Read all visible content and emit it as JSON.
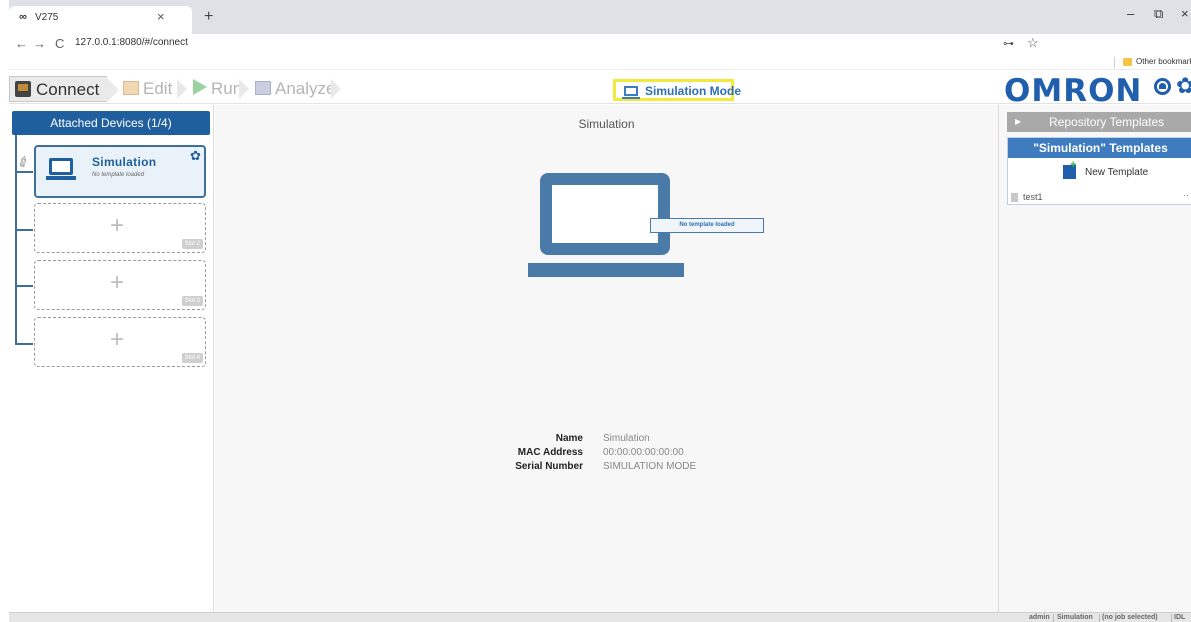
{
  "browser": {
    "tab_title": "V275",
    "tab_icon": "∞",
    "tab_close": "×",
    "new_tab": "+",
    "window_controls": {
      "minimize": "–",
      "restore": "⧉",
      "close": "×"
    },
    "nav": {
      "back": "←",
      "forward": "→",
      "reload": "C"
    },
    "url_info": "ⓘ",
    "url": "127.0.0.1:8080/#/connect",
    "key_icon": "⊶",
    "star_icon": "☆",
    "menu_icon": "⋮",
    "bookmark_other": "Other bookmark"
  },
  "app": {
    "breadcrumb": {
      "connect": "Connect",
      "edit": "Edit",
      "run": "Run",
      "analyze": "Analyze"
    },
    "simulation_mode": "Simulation Mode",
    "logo": "OMRON",
    "gear": "✿"
  },
  "left": {
    "header": "Attached Devices (1/4)",
    "device": {
      "name": "Simulation",
      "sub": "No template loaded",
      "gear": "✿"
    },
    "slots": [
      {
        "plus": "+",
        "label": "Slot 2"
      },
      {
        "plus": "+",
        "label": "Slot 3"
      },
      {
        "plus": "+",
        "label": "Slot 4"
      }
    ],
    "plug": "✐"
  },
  "center": {
    "title": "Simulation",
    "tooltip": "No template loaded",
    "info": [
      {
        "key": "Name",
        "value": "Simulation"
      },
      {
        "key": "MAC Address",
        "value": "00:00:00:00:00:00"
      },
      {
        "key": "Serial Number",
        "value": "SIMULATION MODE"
      }
    ]
  },
  "right": {
    "repo_arrow": "▶",
    "repo_header": "Repository Templates",
    "sim_header": "\"Simulation\" Templates",
    "new_template": "New Template",
    "templates": [
      {
        "name": "test1",
        "more": "··"
      }
    ]
  },
  "status": {
    "user": "admin",
    "mode": "Simulation",
    "job": "(no job selected)",
    "tail": "IDL"
  }
}
